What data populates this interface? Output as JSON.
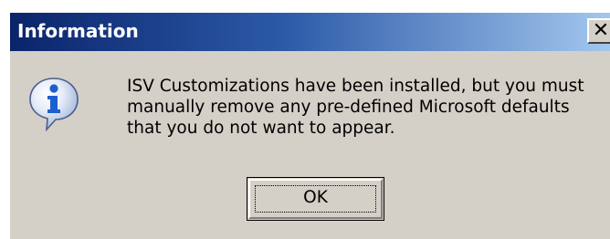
{
  "window": {
    "title": "Information",
    "close_glyph": "✕"
  },
  "message": {
    "lines": [
      "ISV Customizations have been installed, but you must",
      "manually remove any pre-defined Microsoft defaults",
      "that you do not want to appear."
    ]
  },
  "buttons": {
    "ok_label": "OK"
  },
  "icons": {
    "dialog_icon": "information-icon",
    "close_icon": "close-icon"
  },
  "colors": {
    "titlebar_start": "#0a246a",
    "titlebar_end": "#a6caf0",
    "dialog_background": "#d4d0c8",
    "icon_blue": "#1e5fd0"
  }
}
